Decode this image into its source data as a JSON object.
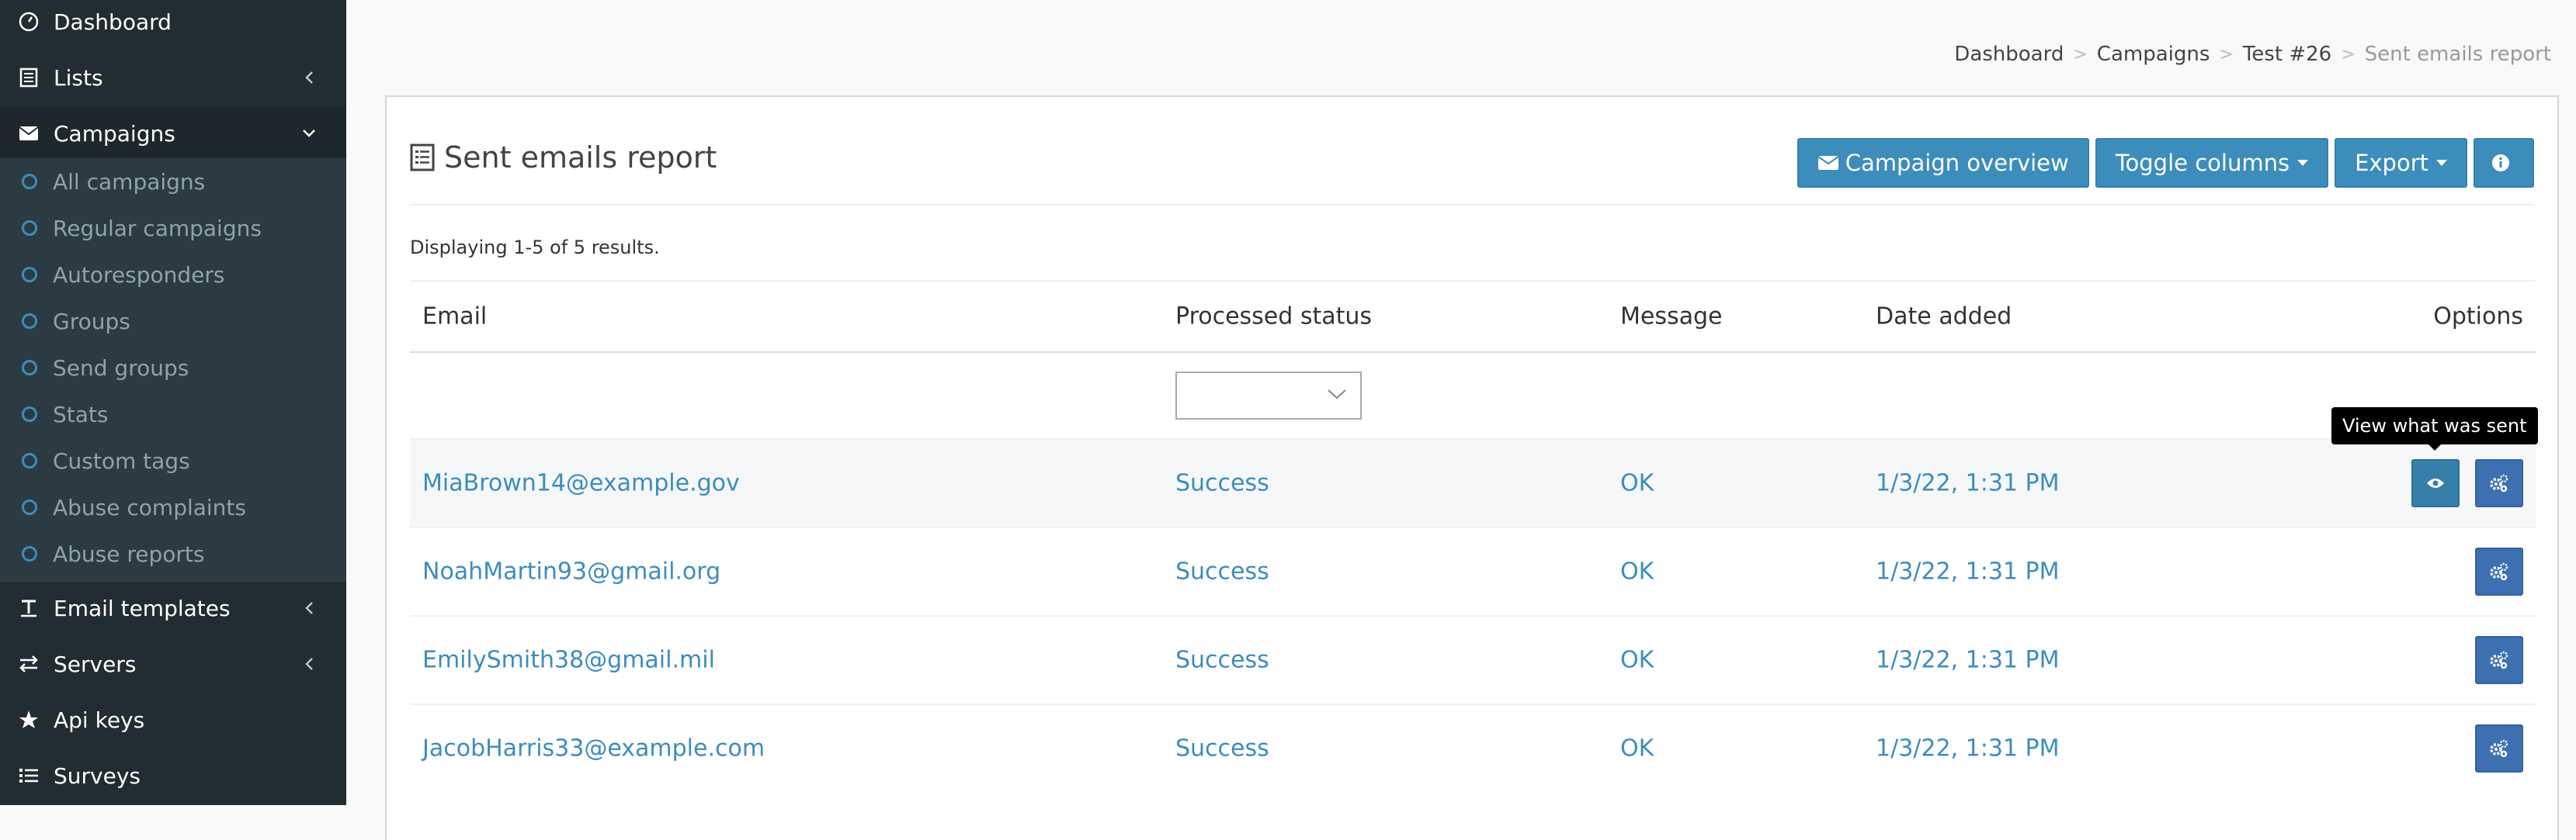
{
  "sidebar": {
    "dashboard": "Dashboard",
    "lists": "Lists",
    "campaigns": "Campaigns",
    "campaign_items": [
      "All campaigns",
      "Regular campaigns",
      "Autoresponders",
      "Groups",
      "Send groups",
      "Stats",
      "Custom tags",
      "Abuse complaints",
      "Abuse reports"
    ],
    "email_templates": "Email templates",
    "servers": "Servers",
    "api_keys": "Api keys",
    "surveys": "Surveys"
  },
  "breadcrumb": [
    "Dashboard",
    "Campaigns",
    "Test #26",
    "Sent emails report"
  ],
  "box": {
    "title": "Sent emails report",
    "campaign_overview": "Campaign overview",
    "toggle_columns": "Toggle columns",
    "export": "Export",
    "summary": "Displaying 1-5 of 5 results."
  },
  "table": {
    "headers": {
      "email": "Email",
      "status": "Processed status",
      "message": "Message",
      "date": "Date added",
      "options": "Options"
    },
    "filter_status_value": "",
    "rows": [
      {
        "email": "MiaBrown14@example.gov",
        "status": "Success",
        "message": "OK",
        "date": "1/3/22, 1:31 PM"
      },
      {
        "email": "NoahMartin93@gmail.org",
        "status": "Success",
        "message": "OK",
        "date": "1/3/22, 1:31 PM"
      },
      {
        "email": "EmilySmith38@gmail.mil",
        "status": "Success",
        "message": "OK",
        "date": "1/3/22, 1:31 PM"
      },
      {
        "email": "JacobHarris33@example.com",
        "status": "Success",
        "message": "OK",
        "date": "1/3/22, 1:31 PM"
      }
    ]
  },
  "tooltip": "View what was sent",
  "colors": {
    "sidebar_bg": "#222d32",
    "submenu_bg": "#2c3b41",
    "accent": "#3c8dbc",
    "link": "#3c8dbc"
  }
}
